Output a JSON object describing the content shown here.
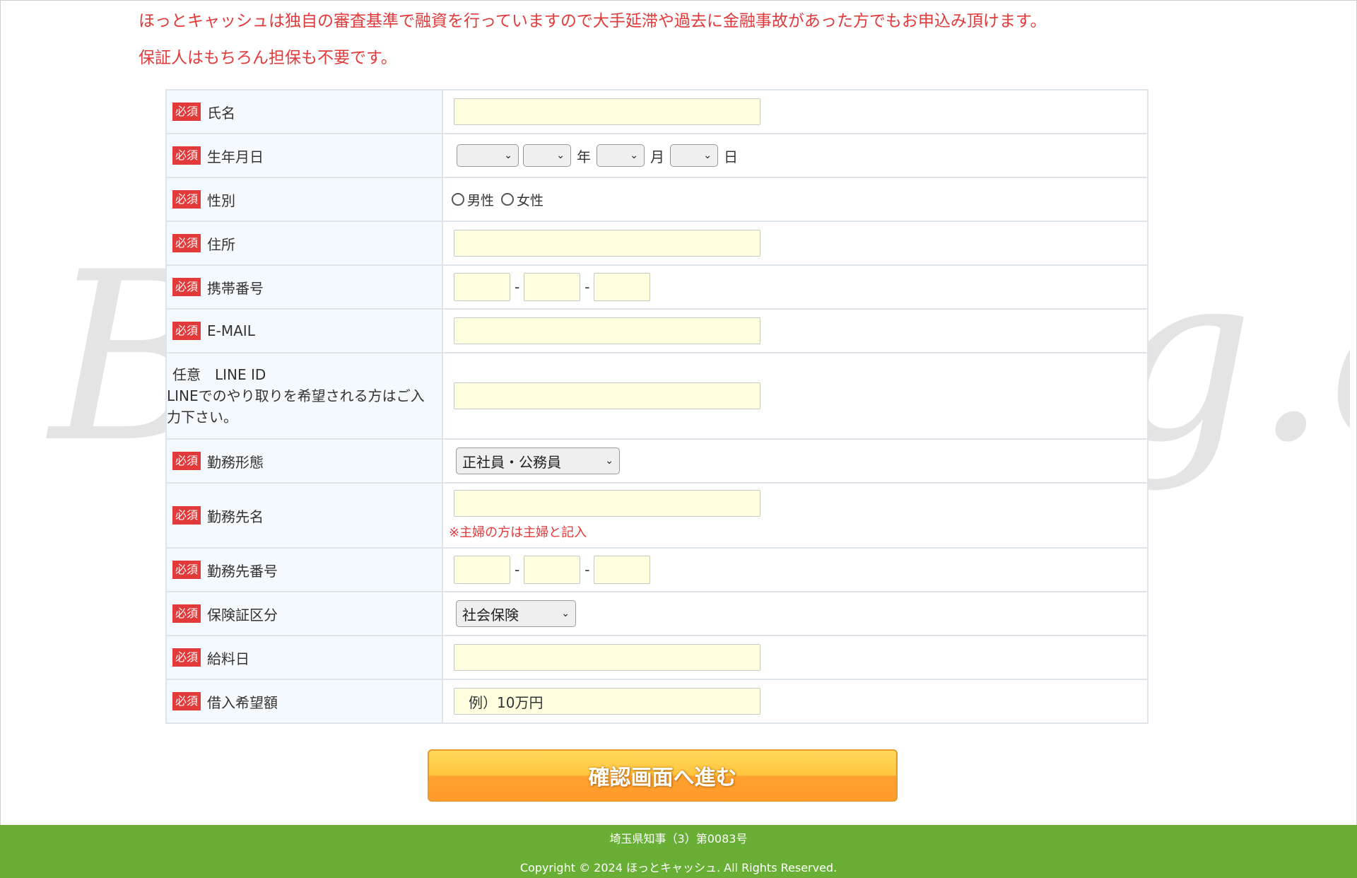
{
  "intro": {
    "line1": "ほっとキャッシュは独自の審査基準で融資を行っていますので大手延滞や過去に金融事故があった方でもお申込み頂けます。",
    "line2": "保証人はもちろん担保も不要です。"
  },
  "required_badge": "必須",
  "form": {
    "name_label": "氏名",
    "birth_label": "生年月日",
    "birth_units": {
      "year": "年",
      "month": "月",
      "day": "日"
    },
    "gender_label": "性別",
    "gender_options": [
      "男性",
      "女性"
    ],
    "address_label": "住所",
    "mobile_label": "携帯番号",
    "email_label": "E-MAIL",
    "line_label": "任意　LINE ID",
    "line_desc": "LINEでのやり取りを希望される方はご入力下さい。",
    "employment_label": "勤務形態",
    "employment_value": "正社員・公務員",
    "employer_label": "勤務先名",
    "employer_note": "※主婦の方は主婦と記入",
    "employer_phone_label": "勤務先番号",
    "insurance_label": "保険証区分",
    "insurance_value": "社会保険",
    "payday_label": "給料日",
    "amount_label": "借入希望額",
    "amount_placeholder": "例）10万円",
    "dash": "-"
  },
  "submit_label": "確認画面へ進む",
  "footer": {
    "license": "埼玉県知事（3）第0083号",
    "copyright": "Copyright © 2024 ほっとキャッシュ. All Rights Reserved."
  },
  "watermark_text": "Banking-g.com"
}
